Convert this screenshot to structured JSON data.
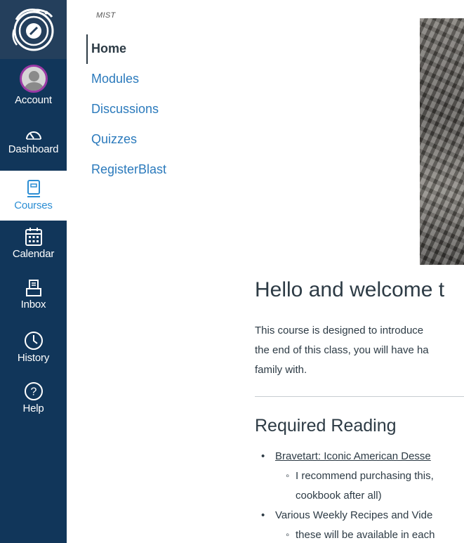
{
  "global_nav": {
    "account": "Account",
    "dashboard": "Dashboard",
    "courses": "Courses",
    "calendar": "Calendar",
    "inbox": "Inbox",
    "history": "History",
    "help": "Help",
    "help_glyph": "?"
  },
  "course_nav": {
    "breadcrumb": "MIST",
    "items": [
      "Home",
      "Modules",
      "Discussions",
      "Quizzes",
      "RegisterBlast"
    ]
  },
  "content": {
    "title": "Hello and welcome t",
    "intro_lines": [
      "This course is designed to introduce",
      "the end of this class, you will have ha",
      "family with."
    ],
    "required_heading": "Required Reading",
    "list": {
      "item1_link": "Bravetart: Iconic American Desse",
      "item1_sub_line1": "I recommend purchasing this,",
      "item1_sub_line2": "cookbook after all)",
      "item2": "Various Weekly Recipes and Vide",
      "item2_sub": "these will be available in each"
    }
  },
  "colors": {
    "nav_bg": "#11365a",
    "link": "#2b7abc",
    "active_course_icon": "#2c8ed4"
  },
  "icons": [
    "logo-icon",
    "account-avatar-icon",
    "dashboard-icon",
    "courses-icon",
    "calendar-icon",
    "inbox-icon",
    "history-icon",
    "help-icon"
  ]
}
